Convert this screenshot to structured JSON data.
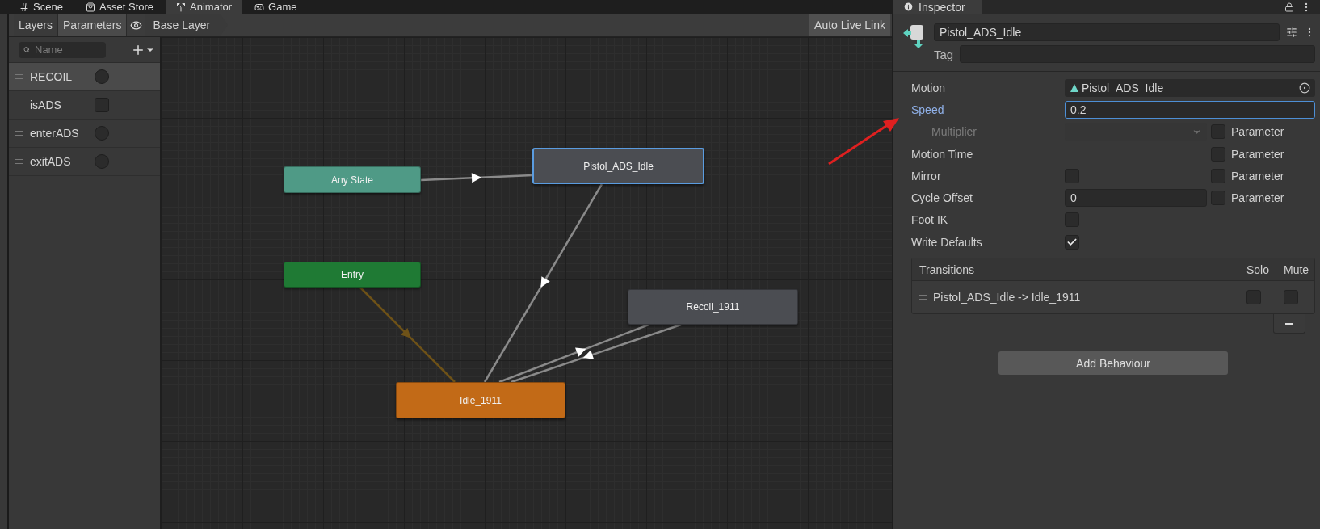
{
  "top_tabs": [
    {
      "label": "Scene",
      "selected": false
    },
    {
      "label": "Asset Store",
      "selected": false
    },
    {
      "label": "Animator",
      "selected": true
    },
    {
      "label": "Game",
      "selected": false
    }
  ],
  "animator_toolbar": {
    "tabs": [
      {
        "label": "Layers",
        "selected": false
      },
      {
        "label": "Parameters",
        "selected": true
      }
    ],
    "breadcrumb": "Base Layer",
    "live_link_button": "Auto Live Link"
  },
  "parameters": {
    "search": {
      "placeholder": "Name"
    },
    "items": [
      {
        "name": "RECOIL",
        "kind": "trigger",
        "selected": true
      },
      {
        "name": "isADS",
        "kind": "bool",
        "selected": false
      },
      {
        "name": "enterADS",
        "kind": "trigger",
        "selected": false
      },
      {
        "name": "exitADS",
        "kind": "trigger",
        "selected": false
      }
    ]
  },
  "graph": {
    "states": [
      {
        "name": "Any State",
        "kind": "any",
        "selected": false
      },
      {
        "name": "Pistol_ADS_Idle",
        "kind": "state",
        "selected": true
      },
      {
        "name": "Entry",
        "kind": "entry",
        "selected": false
      },
      {
        "name": "Recoil_1911",
        "kind": "state",
        "selected": false
      },
      {
        "name": "Idle_1911",
        "kind": "default",
        "selected": false
      }
    ]
  },
  "inspector": {
    "tab": {
      "label": "Inspector"
    },
    "name_field": {
      "value": "Pistol_ADS_Idle"
    },
    "tag_label": "Tag",
    "properties": [
      {
        "label": "Motion",
        "kind": "object",
        "value": "Pistol_ADS_Idle"
      },
      {
        "label": "Speed",
        "kind": "number",
        "value": "0.2",
        "focused": true
      },
      {
        "label": "Multiplier",
        "kind": "dropdown",
        "disabled": true,
        "parameter": {
          "label": "Parameter",
          "checked": false
        }
      },
      {
        "label": "Motion Time",
        "kind": "empty",
        "parameter": {
          "label": "Parameter",
          "checked": false
        }
      },
      {
        "label": "Mirror",
        "kind": "checkbox",
        "checked": false,
        "parameter": {
          "label": "Parameter",
          "checked": false
        }
      },
      {
        "label": "Cycle Offset",
        "kind": "number",
        "value": "0",
        "focused": false,
        "parameter": {
          "label": "Parameter",
          "checked": false
        }
      },
      {
        "label": "Foot IK",
        "kind": "checkbox",
        "checked": false
      },
      {
        "label": "Write Defaults",
        "kind": "checkbox",
        "checked": true
      }
    ],
    "transitions": {
      "title": "Transitions",
      "solo_label": "Solo",
      "mute_label": "Mute",
      "items": [
        {
          "label": "Pistol_ADS_Idle -> Idle_1911",
          "solo": false,
          "mute": false
        }
      ]
    },
    "add_behaviour_button": "Add Behaviour"
  }
}
